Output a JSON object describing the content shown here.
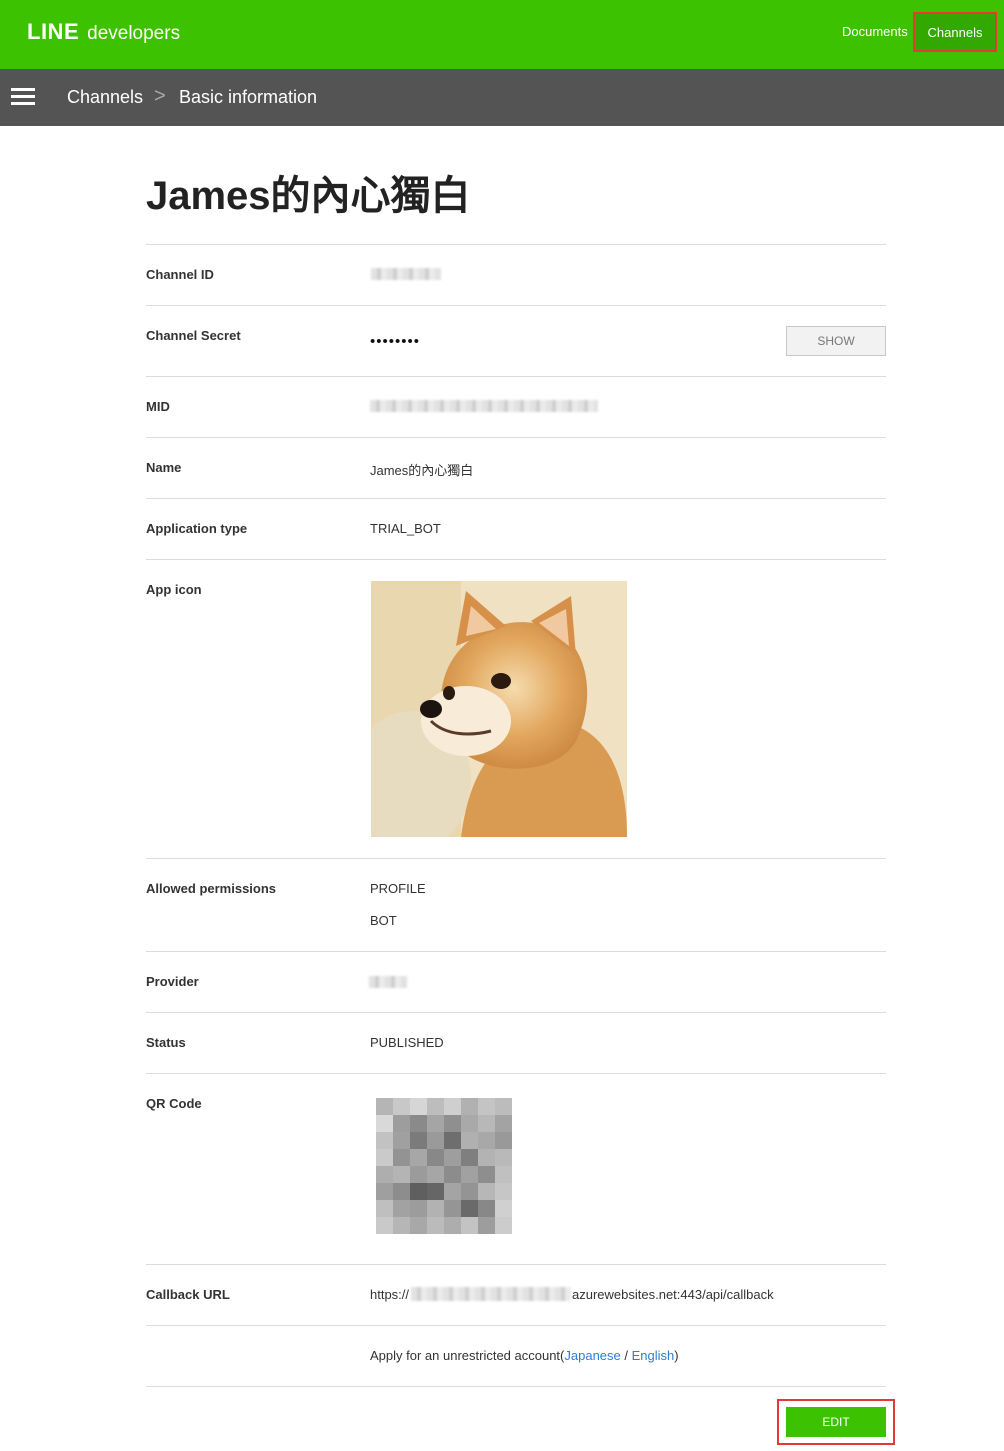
{
  "header": {
    "logo_line": "LINE",
    "logo_developers": "developers",
    "nav_documents": "Documents",
    "nav_channels": "Channels"
  },
  "breadcrumb": {
    "item1": "Channels",
    "separator": ">",
    "item2": "Basic information"
  },
  "page_title": "James的內心獨白",
  "fields": {
    "channel_id_label": "Channel ID",
    "channel_secret_label": "Channel Secret",
    "channel_secret_masked": "••••••••",
    "show_button": "SHOW",
    "mid_label": "MID",
    "name_label": "Name",
    "name_value": "James的內心獨白",
    "app_type_label": "Application type",
    "app_type_value": "TRIAL_BOT",
    "app_icon_label": "App icon",
    "permissions_label": "Allowed permissions",
    "permission_1": "PROFILE",
    "permission_2": "BOT",
    "provider_label": "Provider",
    "status_label": "Status",
    "status_value": "PUBLISHED",
    "qr_label": "QR Code",
    "callback_label": "Callback URL",
    "callback_prefix": "https://",
    "callback_suffix": "azurewebsites.net:443/api/callback",
    "apply_text": "Apply for an unrestricted account(",
    "apply_link_jp": "Japanese",
    "apply_slash": " / ",
    "apply_link_en": "English",
    "apply_close": ")"
  },
  "edit_button": "EDIT",
  "colors": {
    "brand_green": "#3dc200",
    "breadcrumb_bg": "#545454",
    "highlight_red": "#e53935",
    "link_blue": "#2f7dd2"
  }
}
